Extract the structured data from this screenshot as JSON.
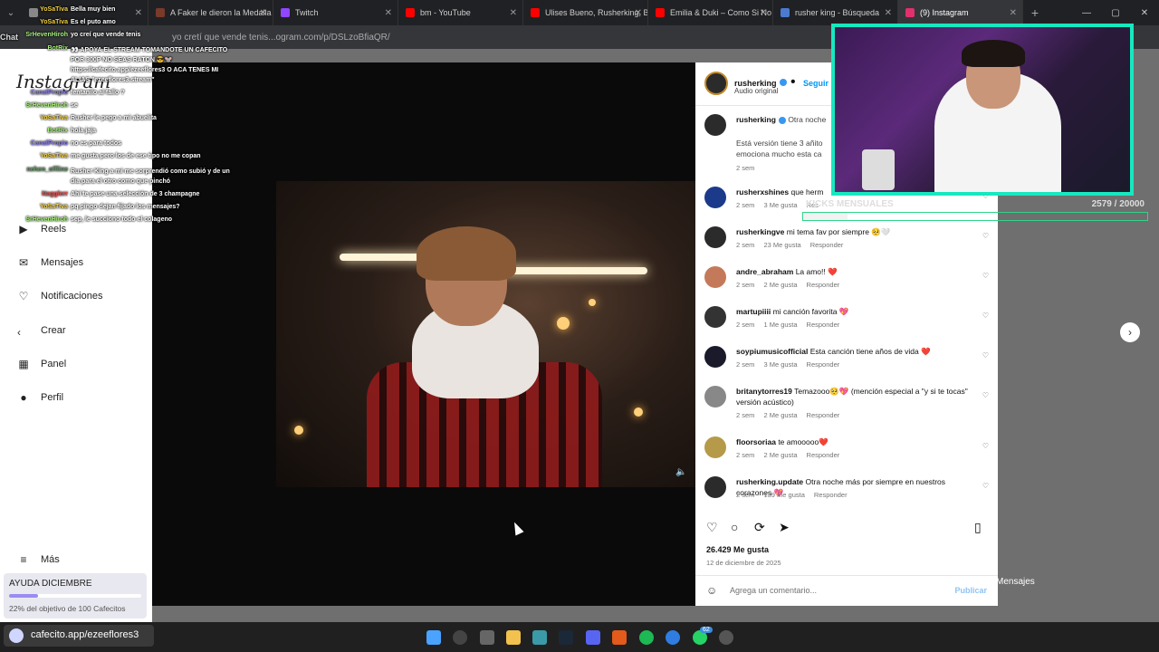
{
  "tabs": [
    {
      "label": "",
      "active": false,
      "color": "#888"
    },
    {
      "label": "A Faker le dieron la Medalla",
      "active": false,
      "color": "#7a3a2a"
    },
    {
      "label": "Twitch",
      "active": false,
      "color": "#9146ff"
    },
    {
      "label": "bm - YouTube",
      "active": false,
      "color": "#ff0000"
    },
    {
      "label": "Ulises Bueno, Rusherking, Bi",
      "active": false,
      "color": "#ff0000"
    },
    {
      "label": "Emilia & Duki – Como Si No",
      "active": false,
      "color": "#ff0000"
    },
    {
      "label": "rusher king - Búsqueda",
      "active": false,
      "color": "#4a7bd0"
    },
    {
      "label": "(9) Instagram",
      "active": true,
      "color": "#e1306c"
    }
  ],
  "address": {
    "url": "yo cretí que vende tenis...ogram.com/p/DSLzoBfiaQR/",
    "chat_label": "Chat"
  },
  "sidebar": {
    "logo": "Instagram",
    "items": [
      {
        "label": "Reels",
        "icon": "reels-icon"
      },
      {
        "label": "Mensajes",
        "icon": "messages-icon"
      },
      {
        "label": "Notificaciones",
        "icon": "heart-icon"
      },
      {
        "label": "Crear",
        "icon": "plus-icon"
      },
      {
        "label": "Panel",
        "icon": "chart-icon"
      },
      {
        "label": "Perfil",
        "icon": "avatar-icon"
      },
      {
        "label": "Más",
        "icon": "menu-icon"
      }
    ]
  },
  "post": {
    "author": "rusherking",
    "follow": "Seguir",
    "audio": "Audio original",
    "caption_author": "rusherking",
    "caption": "Otra noche",
    "caption_body": "Está versión tiene 3 añito emociona mucho esta ca",
    "caption_time": "2 sem",
    "likes": "26.429 Me gusta",
    "date": "12 de diciembre de 2025",
    "comment_placeholder": "Agrega un comentario...",
    "publish": "Publicar"
  },
  "comments": [
    {
      "user": "rusherxshines",
      "text": "que herm",
      "time": "2 sem",
      "likes": "3 Me gusta",
      "reply": "Res"
    },
    {
      "user": "rusherkingve",
      "text": "mi tema fav por siempre 🥺🤍",
      "time": "2 sem",
      "likes": "23 Me gusta",
      "reply": "Responder"
    },
    {
      "user": "andre_abraham",
      "text": "La amo!! ❤️",
      "time": "2 sem",
      "likes": "2 Me gusta",
      "reply": "Responder"
    },
    {
      "user": "martupiiii",
      "text": "mi canción favorita 💖",
      "time": "2 sem",
      "likes": "1 Me gusta",
      "reply": "Responder"
    },
    {
      "user": "soypiumusicofficial",
      "text": "Esta canción tiene años de vida ❤️",
      "time": "2 sem",
      "likes": "3 Me gusta",
      "reply": "Responder"
    },
    {
      "user": "britanytorres19",
      "text": "Temazooo🥺💖 (mención especial a \"y si te tocas\" versión acústico)",
      "time": "2 sem",
      "likes": "2 Me gusta",
      "reply": "Responder"
    },
    {
      "user": "floorsoriaa",
      "text": "te amooooo❤️",
      "time": "2 sem",
      "likes": "2 Me gusta",
      "reply": "Responder"
    },
    {
      "user": "rusherking.update",
      "text": "Otra noche más por siempre en nuestros corazones 💖",
      "time": "2 sem",
      "likes": "139 Me gusta",
      "reply": "Responder"
    }
  ],
  "chat": [
    {
      "user": "YoSaTiva",
      "text": "Bella muy bien",
      "color": "#f4d03f"
    },
    {
      "user": "YoSaTiva",
      "text": "Es el puto amo",
      "color": "#f4d03f"
    },
    {
      "user": "SrHevenHiroh",
      "text": "yo creí que vende tenis",
      "color": "#a7f07a"
    },
    {
      "user": "BotRix",
      "text": "👀 APOYA EL STREAM TOMANDOTE UN CAFECITO POR 300P NO SEAS RATON 😎🐭 https://cafecito.app/ezeeflores3 O ACA TENES MI ALIAS \"ezeeflores3.stream\"",
      "color": "#a7f07a"
    },
    {
      "user": "CanalPropio",
      "text": "fentanilo al fallo ?",
      "color": "#8a7cf0"
    },
    {
      "user": "SrHevenHiroh",
      "text": "se",
      "color": "#a7f07a"
    },
    {
      "user": "YoSaTiva",
      "text": "Rusher le pego a mi abuelita",
      "color": "#f4d03f"
    },
    {
      "user": "BotRix",
      "text": "hola jaja",
      "color": "#a7f07a"
    },
    {
      "user": "CanalPropio",
      "text": "no es para todos",
      "color": "#8a7cf0"
    },
    {
      "user": "YoSaTiva",
      "text": "me gusta pero los de ese tipo no me copan",
      "color": "#f4d03f"
    },
    {
      "user": "nehen_offline",
      "text": "Rusher King a mi me sorprendió como subió y de un dia para el otro como que pinchó",
      "color": "#6a9a6a"
    },
    {
      "user": "Nagglerr",
      "text": "Ahí te pase una selección de 3 champagne",
      "color": "#e05050"
    },
    {
      "user": "YoSaTiva",
      "text": "pq pingo dejan fijado los mensajes?",
      "color": "#f4d03f"
    },
    {
      "user": "SrHevenHiroh",
      "text": "sep, le succiono todo el colageno",
      "color": "#a7f07a"
    }
  ],
  "kicks": {
    "label": "KICKS MENSUALES",
    "count": "2579  / 20000",
    "progress": 0.129
  },
  "ayuda": {
    "title": "AYUDA DICIEMBRE",
    "status": "22% del objetivo de 100 Cafecitos",
    "progress": 0.22
  },
  "cafecito": {
    "label": "cafecito.app/ezeeflores3"
  },
  "bg_messages": {
    "label": "Mensajes"
  },
  "taskbar": {
    "badge": "62"
  }
}
